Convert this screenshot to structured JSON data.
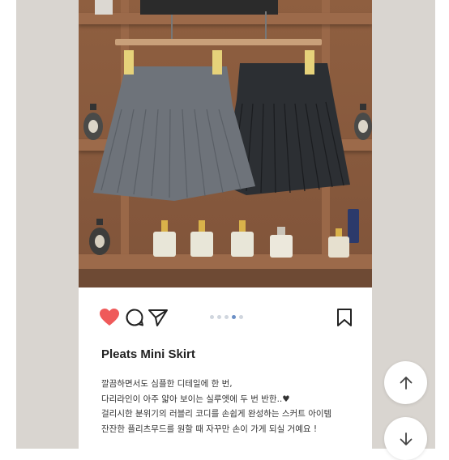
{
  "product": {
    "title": "Pleats Mini Skirt",
    "description_lines": [
      "깔끔하면서도 심플한 디테일에 한 번,",
      "다리라인이 아주 얇아 보이는 실루엣에 두 번 반한..♥",
      "걸리시한 분위기의 러블리 코디를 손쉽게 완성하는 스커트 아이템",
      "잔잔한 플리츠무드를 원할 때 자꾸만 손이 가게 되실 거예요 !"
    ],
    "image_alt_icons": {
      "like": "heart-icon",
      "comment": "comment-icon",
      "share": "send-icon",
      "bookmark": "bookmark-icon"
    }
  },
  "carousel": {
    "total": 5,
    "active_index": 3
  },
  "navigation": {
    "up_icon": "arrow-up-icon",
    "down_icon": "arrow-down-icon"
  },
  "colors": {
    "like": "#ef5a5a",
    "dot_active": "#6b8fc6",
    "dot_inactive": "#d0d6de",
    "page_background": "#d9d5d0"
  }
}
